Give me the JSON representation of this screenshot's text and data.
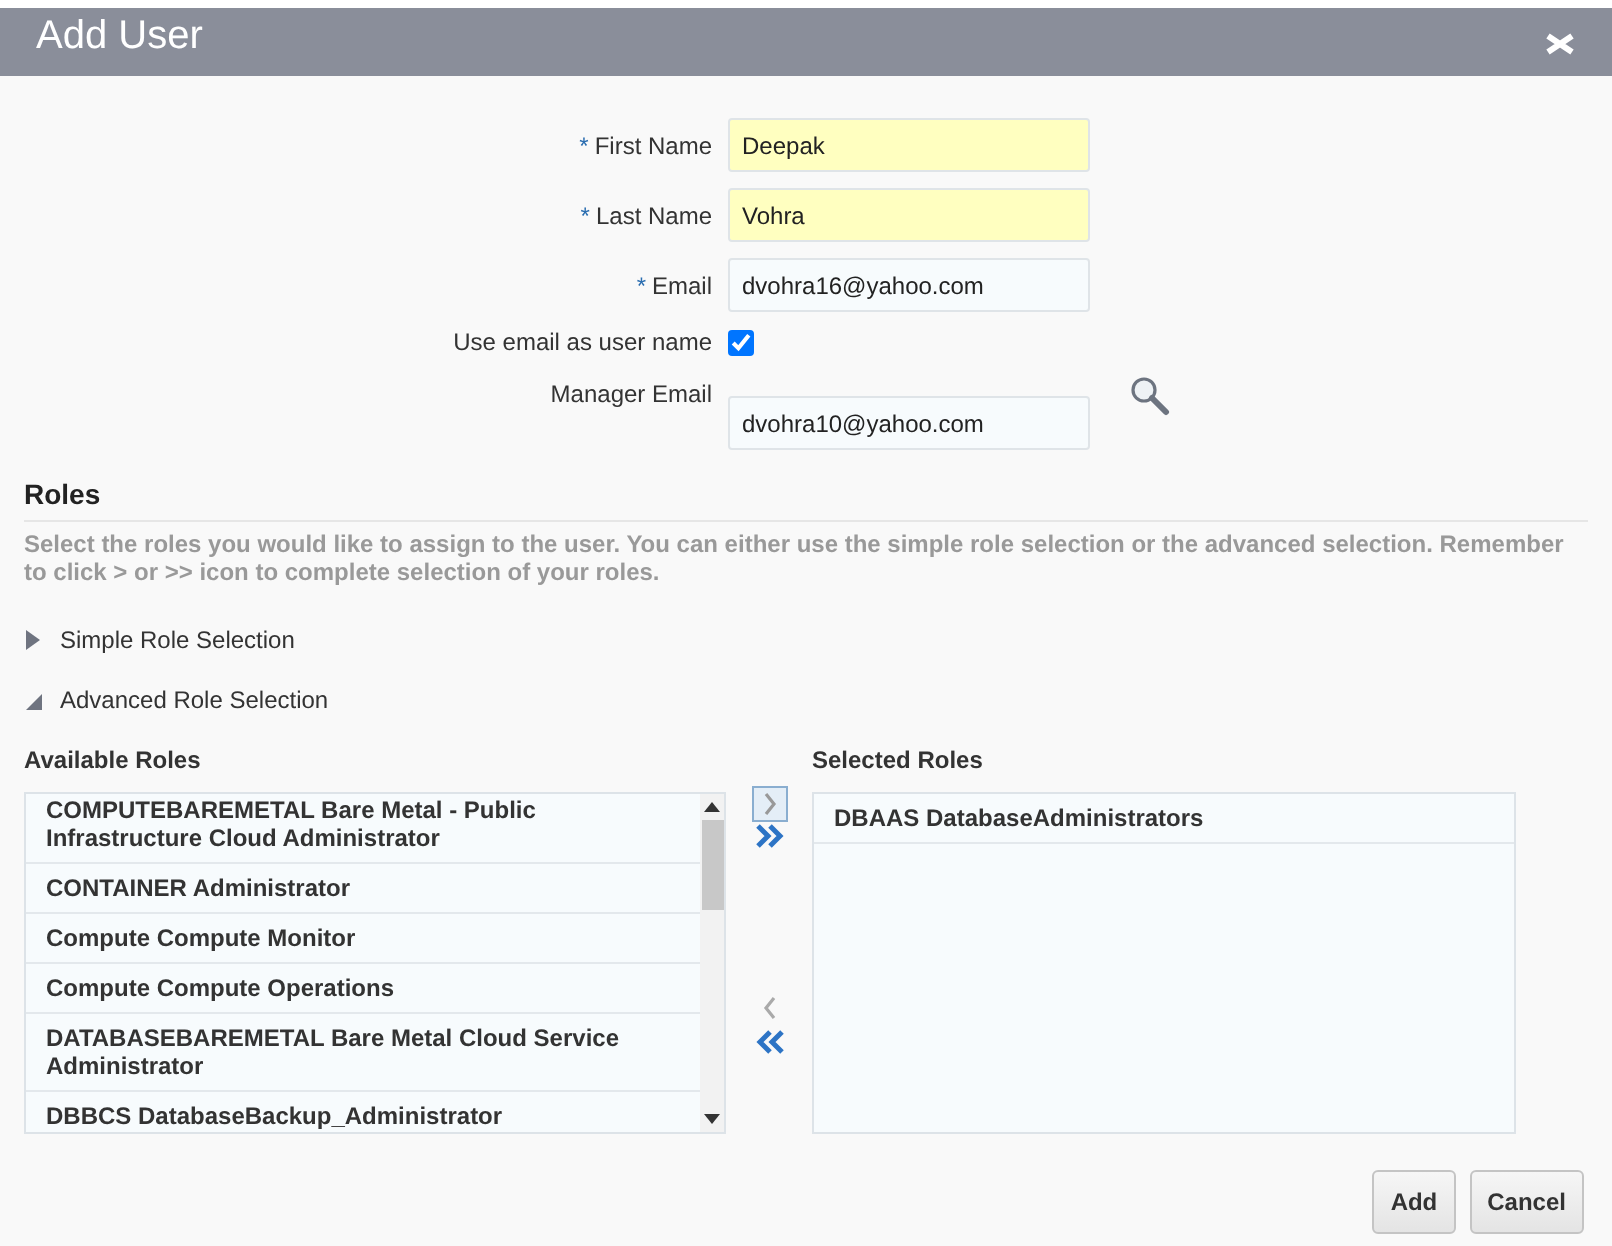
{
  "dialog": {
    "title": "Add User"
  },
  "fields": [
    {
      "kind": "text",
      "marker": "*",
      "label": "First Name",
      "highlighted": true,
      "value": "Deepak"
    },
    {
      "kind": "text",
      "marker": "*",
      "label": "Last Name",
      "highlighted": true,
      "value": "Vohra"
    },
    {
      "kind": "text",
      "marker": "*",
      "label": "Email",
      "highlighted": false,
      "value": "dvohra16@yahoo.com"
    },
    {
      "kind": "checkbox",
      "label": "Use email as user name",
      "checked": true
    },
    {
      "kind": "lookup",
      "label": "Manager Email",
      "highlighted": false,
      "value": "dvohra10@yahoo.com"
    }
  ],
  "roles": {
    "heading": "Roles",
    "description": "Select the roles you would like to assign to the user. You can either use the simple role selection or the advanced selection. Remember to click > or >> icon to complete selection of your roles.",
    "sections": [
      {
        "label": "Simple Role Selection",
        "expanded": false
      },
      {
        "label": "Advanced Role Selection",
        "expanded": true
      }
    ],
    "available": {
      "label": "Available Roles",
      "items": [
        "COMPUTEBAREMETAL Bare Metal - Public Infrastructure Cloud Administrator",
        "CONTAINER Administrator",
        "Compute Compute Monitor",
        "Compute Compute Operations",
        "DATABASEBAREMETAL Bare Metal Cloud Service Administrator",
        "DBBCS DatabaseBackup_Administrator"
      ]
    },
    "selected": {
      "label": "Selected Roles",
      "items": [
        "DBAAS DatabaseAdministrators"
      ]
    }
  },
  "buttons": [
    "Add",
    "Cancel"
  ]
}
